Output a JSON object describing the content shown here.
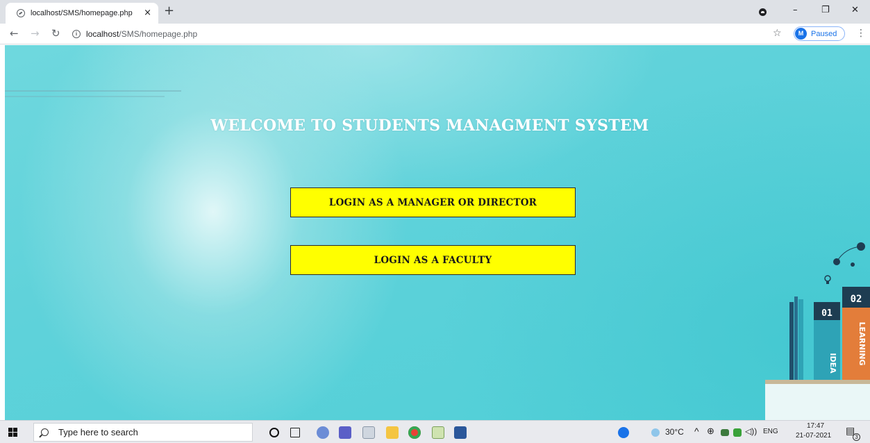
{
  "browser": {
    "tab_title": "localhost/SMS/homepage.php",
    "tab_close": "×",
    "new_tab": "+",
    "url_host": "localhost",
    "url_path": "/SMS/homepage.php",
    "profile_initial": "M",
    "profile_status": "Paused",
    "minimize": "–",
    "restore": "❐",
    "close": "✕"
  },
  "page": {
    "welcome_title": "Welcome to Students Managment System",
    "buttons": [
      {
        "label": "Login as a Manager or Director"
      },
      {
        "label": "Login as a Faculty"
      }
    ],
    "books": {
      "book1_number": "01",
      "book1_text": "IDEA",
      "book2_number": "02",
      "book2_text": "LEARNING"
    }
  },
  "taskbar": {
    "search_placeholder": "Type here to search",
    "weather": "30°C",
    "language": "ENG",
    "time": "17:47",
    "date": "21-07-2021",
    "notification_count": "3"
  },
  "colors": {
    "page_bg": "#4fd0d8",
    "button_bg": "#ffff00",
    "title_color": "#ffffff"
  }
}
